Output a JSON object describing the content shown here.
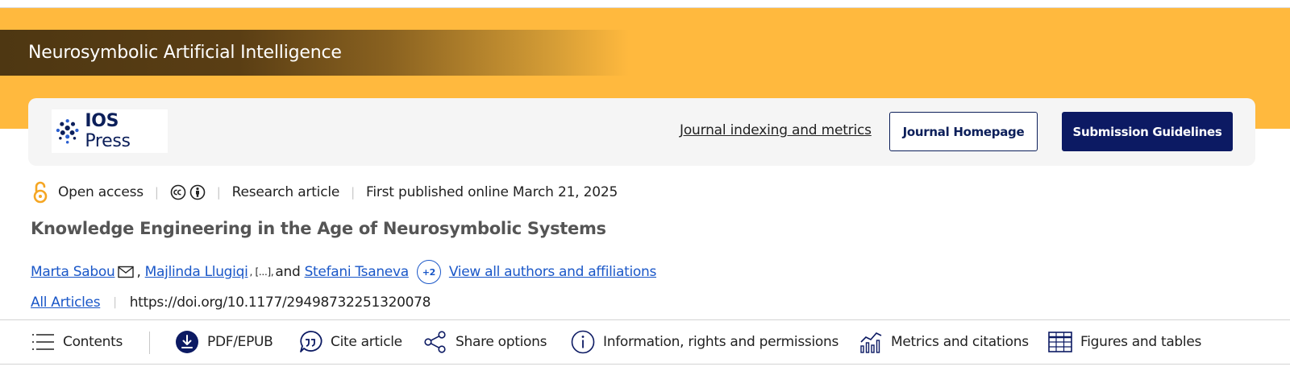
{
  "journal": {
    "title": "Neurosymbolic Artificial Intelligence"
  },
  "publisher": {
    "logo_word_bold": "IOS",
    "logo_word": "Press",
    "indexing_link": "Journal indexing and metrics",
    "homepage_button": "Journal Homepage",
    "guidelines_button": "Submission Guidelines"
  },
  "meta": {
    "access": "Open access",
    "article_type": "Research article",
    "published": "First published online March 21, 2025"
  },
  "article": {
    "title": "Knowledge Engineering in the Age of Neurosymbolic Systems",
    "authors": [
      {
        "name": "Marta Sabou"
      },
      {
        "name": "Majlinda Llugiqi"
      },
      {
        "name": "Stefani Tsaneva"
      }
    ],
    "comma_1": ",",
    "ellipsis": ", [...],",
    "and_text": " and",
    "more_authors_badge": "+2",
    "view_all_link": "View all authors and affiliations",
    "all_articles_link": "All Articles",
    "doi": "https://doi.org/10.1177/29498732251320078"
  },
  "toolbar": {
    "items": [
      {
        "label": "Contents",
        "icon": "list-icon"
      },
      {
        "label": "PDF/EPUB",
        "icon": "download-icon"
      },
      {
        "label": "Cite article",
        "icon": "quote-icon"
      },
      {
        "label": "Share options",
        "icon": "share-icon"
      },
      {
        "label": "Information, rights and permissions",
        "icon": "info-icon"
      },
      {
        "label": "Metrics and citations",
        "icon": "metrics-icon"
      },
      {
        "label": "Figures and tables",
        "icon": "table-icon"
      }
    ]
  },
  "colors": {
    "banner": "#ffb93e",
    "navy": "#0c1a63",
    "link": "#1a57c8",
    "open_access": "#f5a623"
  }
}
